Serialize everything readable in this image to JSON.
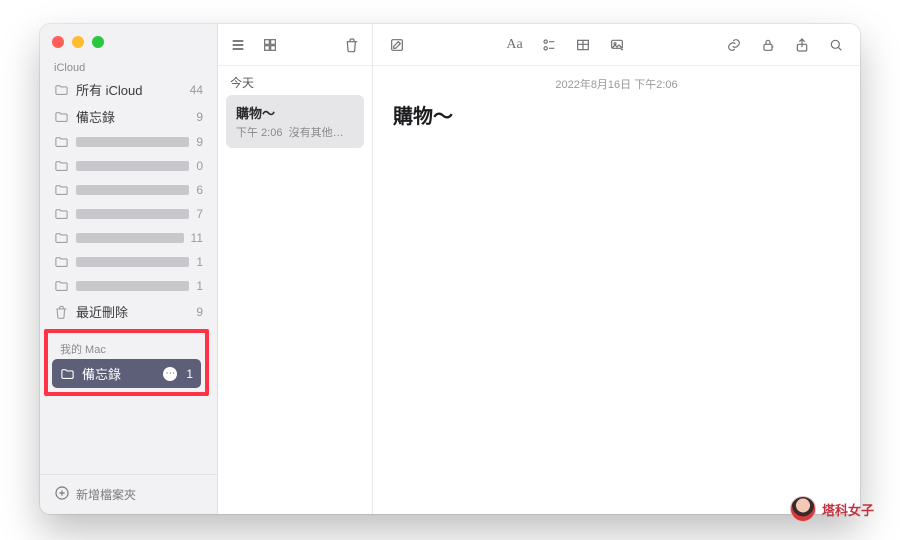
{
  "sidebar": {
    "sections": [
      {
        "label": "iCloud",
        "items": [
          {
            "icon": "folder",
            "name": "所有 iCloud",
            "count": 44,
            "blur": false
          },
          {
            "icon": "folder",
            "name": "備忘錄",
            "count": 9,
            "blur": false
          },
          {
            "icon": "folder",
            "name": "—",
            "count": 9,
            "blur": true
          },
          {
            "icon": "folder",
            "name": "—",
            "count": 0,
            "blur": true
          },
          {
            "icon": "folder",
            "name": "—",
            "count": 6,
            "blur": true
          },
          {
            "icon": "folder",
            "name": "—",
            "count": 7,
            "blur": true
          },
          {
            "icon": "folder",
            "name": "—",
            "count": 11,
            "blur": true
          },
          {
            "icon": "folder",
            "name": "—",
            "count": 1,
            "blur": true
          },
          {
            "icon": "folder",
            "name": "—",
            "count": 1,
            "blur": true
          },
          {
            "icon": "trash",
            "name": "最近刪除",
            "count": 9,
            "blur": false
          }
        ]
      },
      {
        "label": "我的 Mac",
        "items": [
          {
            "icon": "folder",
            "name": "備忘錄",
            "count": 1,
            "selected": true
          }
        ]
      }
    ],
    "add_folder_label": "新增檔案夾"
  },
  "list": {
    "group_label": "今天",
    "notes": [
      {
        "title": "購物～",
        "time": "下午 2:06",
        "preview": "沒有其他…"
      }
    ]
  },
  "editor": {
    "timestamp": "2022年8月16日 下午2:06",
    "title": "購物～"
  },
  "watermark": "塔科女子"
}
